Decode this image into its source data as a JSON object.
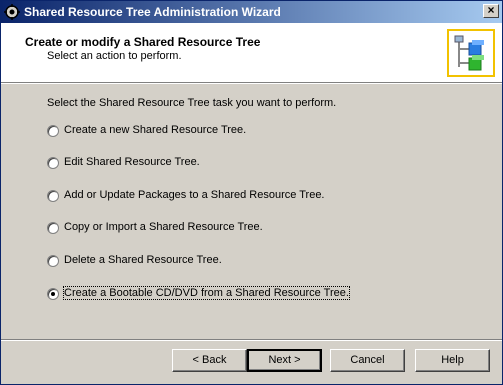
{
  "window": {
    "title": "Shared Resource Tree Administration Wizard",
    "close_label": "×"
  },
  "header": {
    "title": "Create or modify a Shared Resource Tree",
    "subtitle": "Select an action to perform."
  },
  "body": {
    "prompt": "Select the Shared Resource Tree task you want to perform.",
    "options": [
      {
        "label": "Create a new Shared Resource Tree.",
        "selected": false
      },
      {
        "label": "Edit Shared Resource Tree.",
        "selected": false
      },
      {
        "label": "Add or Update Packages to a Shared Resource Tree.",
        "selected": false
      },
      {
        "label": "Copy or Import a Shared Resource Tree.",
        "selected": false
      },
      {
        "label": "Delete a Shared Resource Tree.",
        "selected": false
      },
      {
        "label": "Create a Bootable CD/DVD from a Shared Resource Tree.",
        "selected": true
      }
    ]
  },
  "buttons": {
    "back": "< Back",
    "next": "Next >",
    "cancel": "Cancel",
    "help": "Help"
  },
  "colors": {
    "titlebar_start": "#0a246a",
    "titlebar_end": "#a6caf0",
    "dialog_bg": "#d4d0c8",
    "icon_frame": "#f2c200"
  }
}
